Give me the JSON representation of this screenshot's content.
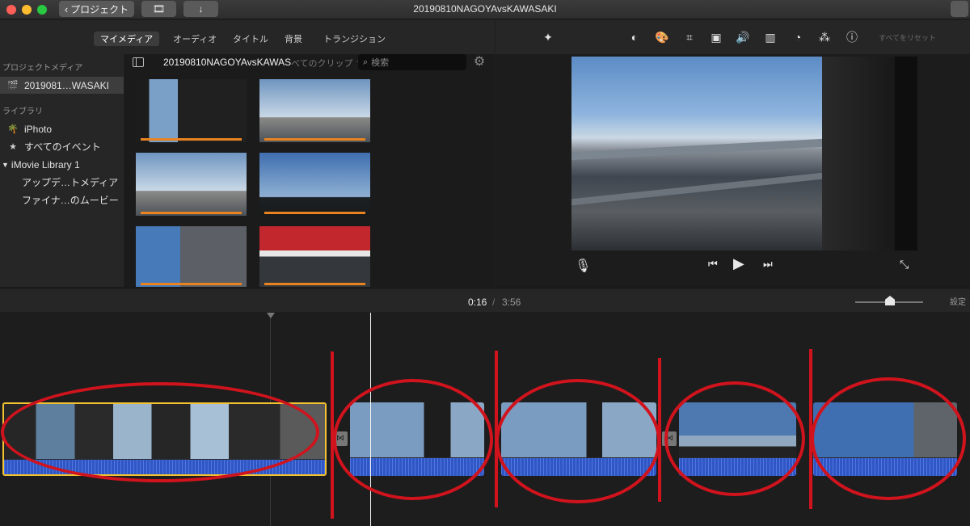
{
  "window": {
    "title": "20190810NAGOYAvsKAWASAKI"
  },
  "titlebar": {
    "back_label": "プロジェクト",
    "back_icon": "chevron-left-icon",
    "film_icon": "film-music-icon",
    "import_icon": "down-arrow-icon"
  },
  "tabs": [
    {
      "label": "マイメディア",
      "active": true
    },
    {
      "label": "オーディオ",
      "active": false
    },
    {
      "label": "タイトル",
      "active": false
    },
    {
      "label": "背景",
      "active": false
    },
    {
      "label": "トランジション",
      "active": false
    }
  ],
  "sidebar": {
    "project_header": "プロジェクトメディア",
    "project_item": "20190810NAGOYAvsKAWASAKI",
    "project_item_display": "2019081…WASAKI",
    "library_header": "ライブラリ",
    "items": [
      {
        "label": "iPhoto",
        "icon": "palm-tree-icon"
      },
      {
        "label": "すべてのイベント",
        "icon": "star-icon"
      }
    ],
    "library_name": "iMovie Library 1",
    "library_children": [
      {
        "label": "アップデ…トメディア"
      },
      {
        "label": "ファイナ…のムービー"
      }
    ]
  },
  "browser": {
    "title": "20190810NAGOYAvsKAWAS",
    "filter_label": "べてのクリップ",
    "search_placeholder": "検索",
    "gear_icon": "gear-icon"
  },
  "viewer": {
    "reset_label": "すべてをリセット",
    "tools": [
      "magic-wand-icon",
      "color-balance-icon",
      "color-correction-icon",
      "crop-icon",
      "stabilization-icon",
      "volume-icon",
      "noise-reduction-icon",
      "speed-icon",
      "filter-icon",
      "info-icon"
    ]
  },
  "timeline": {
    "current_time": "0:16",
    "separator": "/",
    "total_time": "3:56",
    "settings_label": "設定",
    "transition_icon": "transition-bowtie-icon"
  },
  "colors": {
    "annotation_red": "#d0131c",
    "selection_yellow": "#f2c230",
    "audio_blue": "#2f56c4",
    "clip_progress_orange": "#e9831f"
  }
}
